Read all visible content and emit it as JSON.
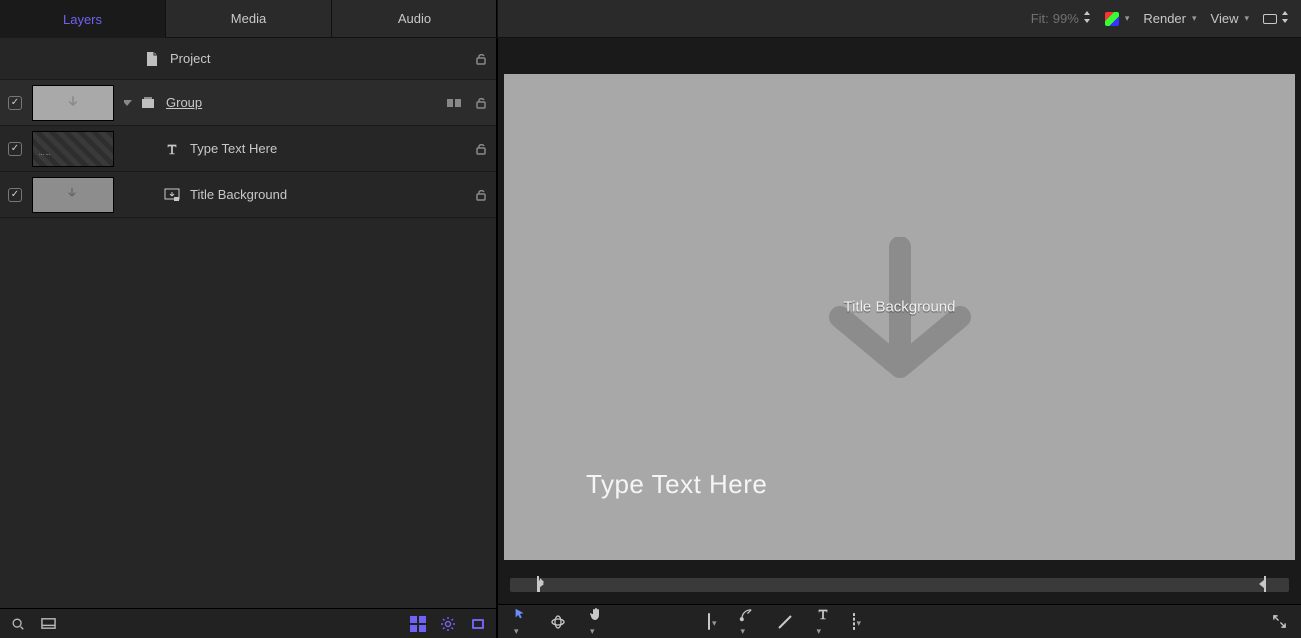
{
  "tabs": {
    "layers": "Layers",
    "media": "Media",
    "audio": "Audio"
  },
  "rows": {
    "project": "Project",
    "group": "Group",
    "text": "Type Text Here",
    "titlebg": "Title Background"
  },
  "canvas": {
    "title_bg_label": "Title Background",
    "type_text": "Type Text Here"
  },
  "toolbar": {
    "fit_label": "Fit:",
    "fit_value": "99%",
    "render": "Render",
    "view": "View"
  }
}
